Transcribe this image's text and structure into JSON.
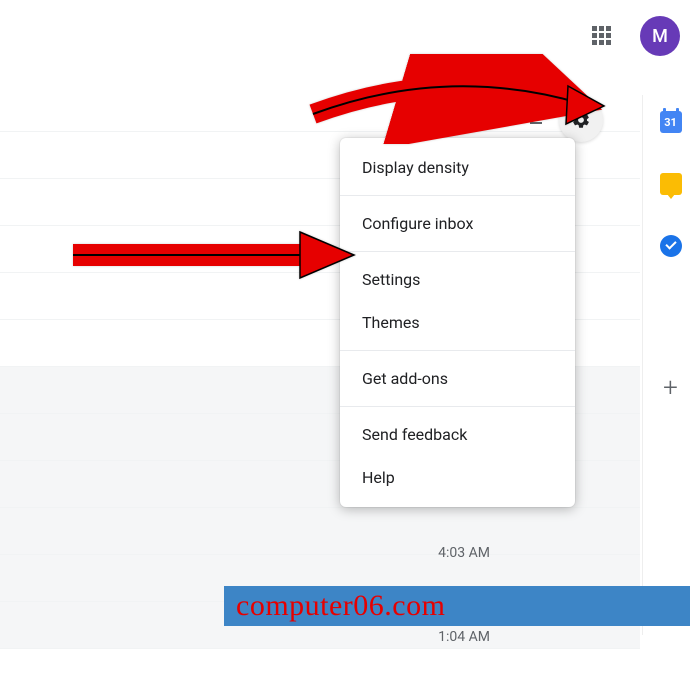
{
  "header": {
    "avatar_initial": "M"
  },
  "sidepanel": {
    "calendar_day": "31"
  },
  "menu": {
    "items": [
      "Display density",
      "Configure inbox",
      "Settings",
      "Themes",
      "Get add-ons",
      "Send feedback",
      "Help"
    ]
  },
  "times": {
    "t1": "4:03 AM",
    "t2": "AM",
    "t3": "1:04 AM"
  },
  "watermark": {
    "text": "computer06.com"
  }
}
